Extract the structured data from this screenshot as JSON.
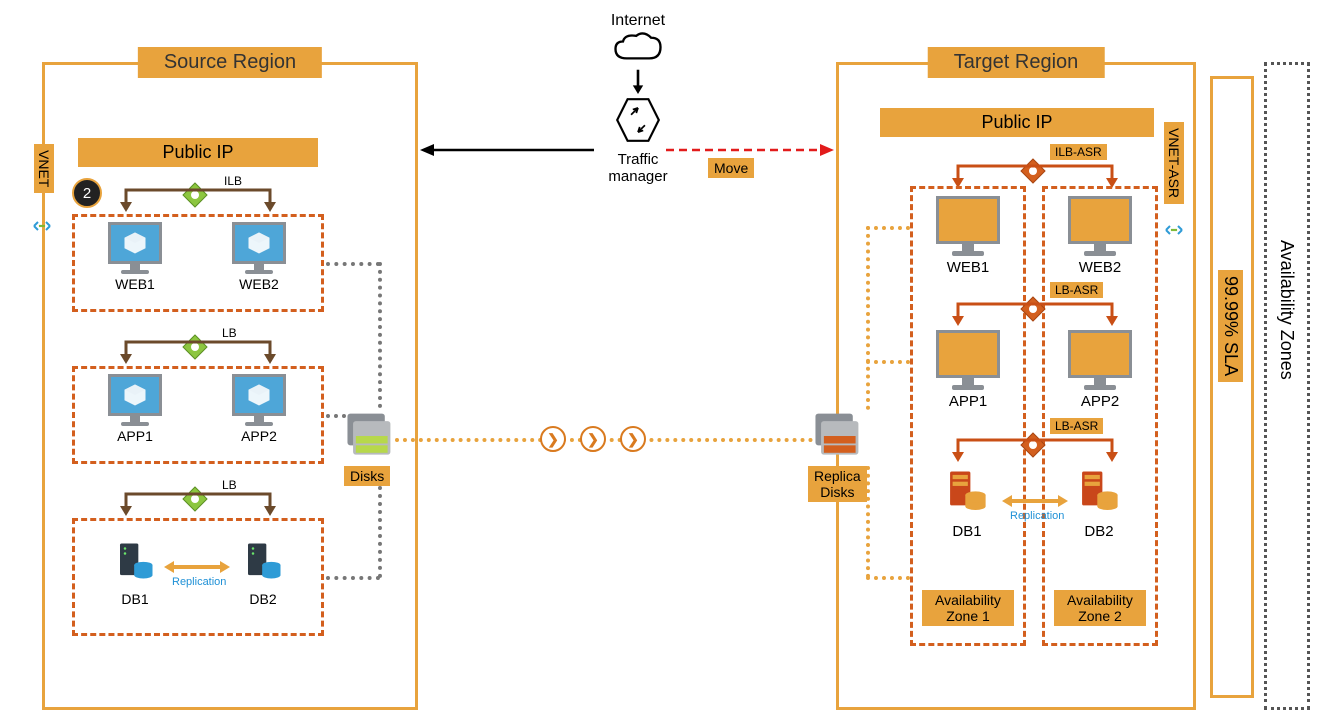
{
  "center": {
    "internet_label": "Internet",
    "traffic_manager_label": "Traffic\nmanager",
    "move_label": "Move"
  },
  "source": {
    "title": "Source Region",
    "public_ip": "Public IP",
    "vnet_label": "VNET",
    "step_number": "2",
    "ilb_label": "ILB",
    "lb_label_mid": "LB",
    "lb_label_bottom": "LB",
    "web1": "WEB1",
    "web2": "WEB2",
    "app1": "APP1",
    "app2": "APP2",
    "db1": "DB1",
    "db2": "DB2",
    "replication_label": "Replication",
    "disks_label": "Disks"
  },
  "target": {
    "title": "Target Region",
    "public_ip": "Public IP",
    "vnet_label": "VNET-ASR",
    "ilb_label": "ILB-ASR",
    "lb_label_mid": "LB-ASR",
    "lb_label_bottom": "LB-ASR",
    "web1": "WEB1",
    "web2": "WEB2",
    "app1": "APP1",
    "app2": "APP2",
    "db1": "DB1",
    "db2": "DB2",
    "replication_label": "Replication",
    "replica_disks_label": "Replica\nDisks",
    "az1_label": "Availability\nZone 1",
    "az2_label": "Availability\nZone 2",
    "sla_label": "99.99% SLA",
    "az_label": "Availability Zones"
  }
}
